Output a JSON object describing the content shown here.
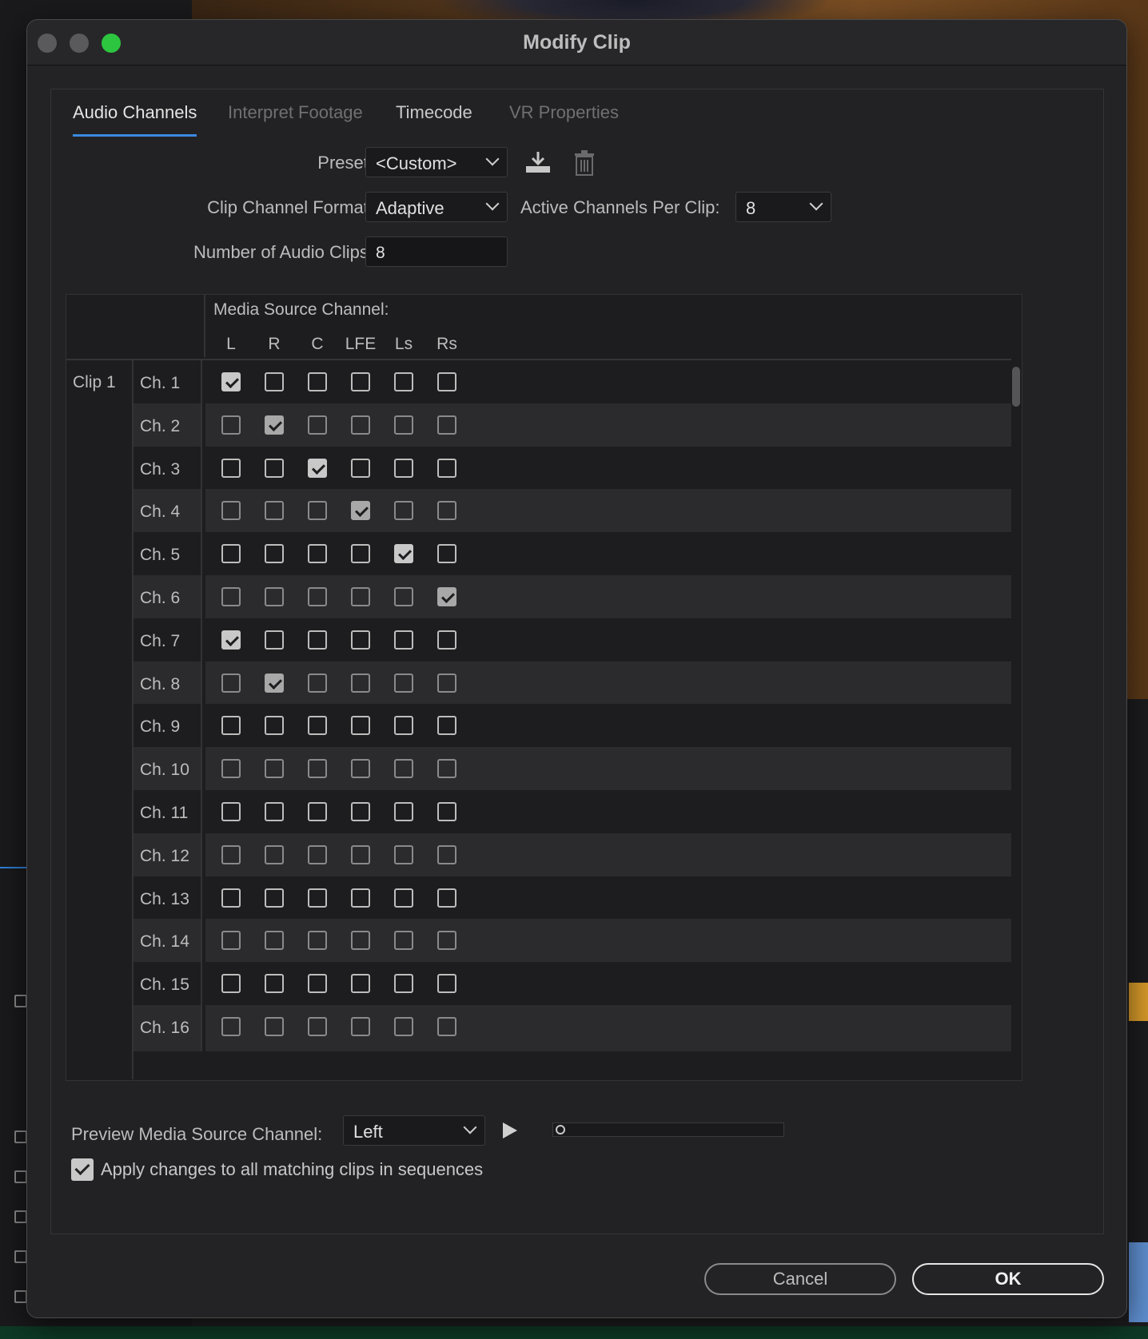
{
  "window": {
    "title": "Modify Clip"
  },
  "tabs": [
    {
      "label": "Audio Channels",
      "state": "active"
    },
    {
      "label": "Interpret Footage",
      "state": "disabled"
    },
    {
      "label": "Timecode",
      "state": "normal"
    },
    {
      "label": "VR Properties",
      "state": "disabled"
    }
  ],
  "preset": {
    "label": "Preset:",
    "value": "<Custom>"
  },
  "clip_channel_format": {
    "label": "Clip Channel Format:",
    "value": "Adaptive"
  },
  "active_channels": {
    "label": "Active Channels Per Clip:",
    "value": "8"
  },
  "num_audio_clips": {
    "label": "Number of Audio Clips:",
    "value": "8"
  },
  "grid": {
    "title": "Media Source Channel:",
    "columns": [
      "L",
      "R",
      "C",
      "LFE",
      "Ls",
      "Rs"
    ],
    "clip_label": "Clip 1",
    "rows": [
      {
        "label": "Ch. 1",
        "checks": [
          1,
          0,
          0,
          0,
          0,
          0
        ]
      },
      {
        "label": "Ch. 2",
        "checks": [
          0,
          1,
          0,
          0,
          0,
          0
        ]
      },
      {
        "label": "Ch. 3",
        "checks": [
          0,
          0,
          1,
          0,
          0,
          0
        ]
      },
      {
        "label": "Ch. 4",
        "checks": [
          0,
          0,
          0,
          1,
          0,
          0
        ]
      },
      {
        "label": "Ch. 5",
        "checks": [
          0,
          0,
          0,
          0,
          1,
          0
        ]
      },
      {
        "label": "Ch. 6",
        "checks": [
          0,
          0,
          0,
          0,
          0,
          1
        ]
      },
      {
        "label": "Ch. 7",
        "checks": [
          1,
          0,
          0,
          0,
          0,
          0
        ]
      },
      {
        "label": "Ch. 8",
        "checks": [
          0,
          1,
          0,
          0,
          0,
          0
        ]
      },
      {
        "label": "Ch. 9",
        "checks": [
          0,
          0,
          0,
          0,
          0,
          0
        ]
      },
      {
        "label": "Ch. 10",
        "checks": [
          0,
          0,
          0,
          0,
          0,
          0
        ]
      },
      {
        "label": "Ch. 11",
        "checks": [
          0,
          0,
          0,
          0,
          0,
          0
        ]
      },
      {
        "label": "Ch. 12",
        "checks": [
          0,
          0,
          0,
          0,
          0,
          0
        ]
      },
      {
        "label": "Ch. 13",
        "checks": [
          0,
          0,
          0,
          0,
          0,
          0
        ]
      },
      {
        "label": "Ch. 14",
        "checks": [
          0,
          0,
          0,
          0,
          0,
          0
        ]
      },
      {
        "label": "Ch. 15",
        "checks": [
          0,
          0,
          0,
          0,
          0,
          0
        ]
      },
      {
        "label": "Ch. 16",
        "checks": [
          0,
          0,
          0,
          0,
          0,
          0
        ]
      }
    ]
  },
  "preview": {
    "label": "Preview Media Source Channel:",
    "value": "Left"
  },
  "apply_all": {
    "label": "Apply changes to all matching clips in sequences",
    "checked": true
  },
  "buttons": {
    "cancel": "Cancel",
    "ok": "OK"
  },
  "icons": {
    "save_preset": "download-icon",
    "delete_preset": "trash-icon",
    "play": "play-icon"
  },
  "colors": {
    "accent": "#3a8ae0",
    "zoom_button": "#2dc53f"
  }
}
